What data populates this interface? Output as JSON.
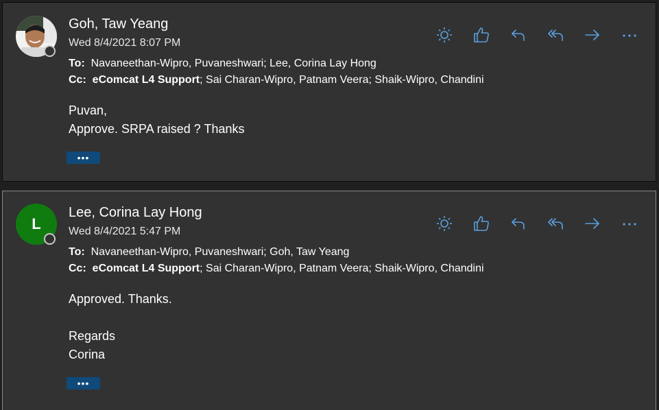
{
  "colors": {
    "card_bg": "#323232",
    "icon": "#5aa0e0",
    "more_button": "#0f4a7a",
    "avatar_green": "#107c10"
  },
  "messages": [
    {
      "sender": "Goh, Taw Yeang",
      "date": "Wed 8/4/2021 8:07 PM",
      "to_label": "To:",
      "to": "Navaneethan-Wipro, Puvaneshwari; Lee, Corina Lay Hong",
      "cc_label": "Cc:",
      "cc_bold": "eComcat L4 Support",
      "cc_rest": "; Sai Charan-Wipro, Patnam Veera; Shaik-Wipro, Chandini",
      "body": [
        "Puvan,",
        "Approve. SRPA raised ? Thanks"
      ],
      "more": "•••",
      "avatar": "photo"
    },
    {
      "sender": "Lee, Corina Lay Hong",
      "date": "Wed 8/4/2021 5:47 PM",
      "to_label": "To:",
      "to": "Navaneethan-Wipro, Puvaneshwari; Goh, Taw Yeang",
      "cc_label": "Cc:",
      "cc_bold": "eComcat L4 Support",
      "cc_rest": "; Sai Charan-Wipro, Patnam Veera; Shaik-Wipro, Chandini",
      "body": [
        "Approved.  Thanks.",
        "",
        "Regards",
        "Corina"
      ],
      "more": "•••",
      "avatar_initial": "L"
    }
  ],
  "action_icons": [
    "sun-icon",
    "thumbs-up-icon",
    "reply-icon",
    "reply-all-icon",
    "forward-icon",
    "more-actions-icon"
  ]
}
